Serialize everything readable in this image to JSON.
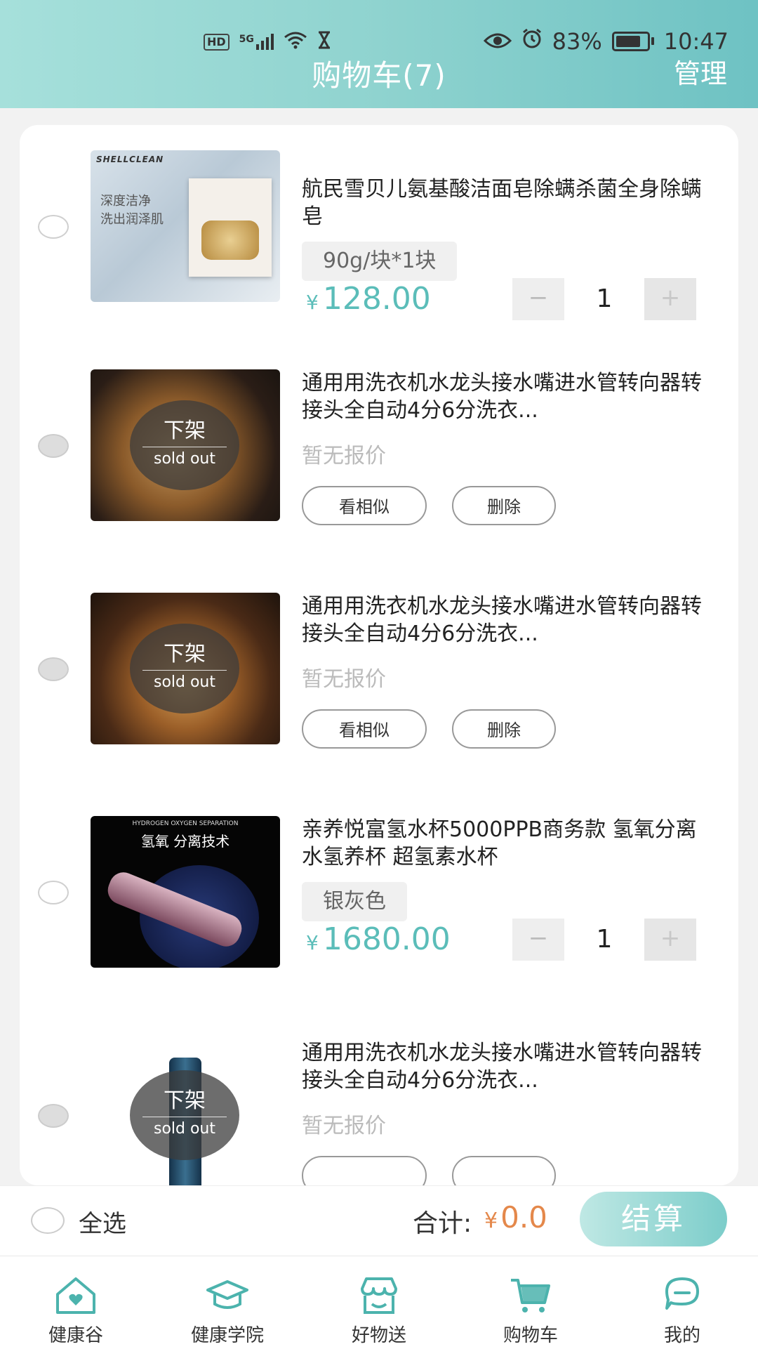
{
  "status_bar": {
    "left_icons": [
      "hd-icon",
      "signal-5g-icon",
      "wifi-icon",
      "hourglass-icon"
    ],
    "hd": "HD",
    "network": "5G",
    "battery": "83%",
    "time": "10:47"
  },
  "header": {
    "title": "购物车(7)",
    "manage": "管理"
  },
  "items": [
    {
      "name": "航民雪贝儿氨基酸洁面皂除螨杀菌全身除螨皂",
      "spec": "90g/块*1块",
      "price_symbol": "¥",
      "price": "128.00",
      "qty": "1",
      "minus": "−",
      "plus": "+"
    },
    {
      "name": "通用用洗衣机水龙头接水嘴进水管转向器转接头全自动4分6分洗衣...",
      "sold_zh": "下架",
      "sold_en": "sold out",
      "noprice": "暂无报价",
      "similar": "看相似",
      "delete": "删除"
    },
    {
      "name": "通用用洗衣机水龙头接水嘴进水管转向器转接头全自动4分6分洗衣...",
      "sold_zh": "下架",
      "sold_en": "sold out",
      "noprice": "暂无报价",
      "similar": "看相似",
      "delete": "删除"
    },
    {
      "name": "亲养悦富氢水杯5000PPB商务款 氢氧分离水氢养杯 超氢素水杯",
      "spec": "银灰色",
      "price_symbol": "¥",
      "price": "1680.00",
      "qty": "1",
      "minus": "−",
      "plus": "+"
    },
    {
      "name": "通用用洗衣机水龙头接水嘴进水管转向器转接头全自动4分6分洗衣...",
      "sold_zh": "下架",
      "sold_en": "sold out",
      "noprice": "暂无报价"
    }
  ],
  "thumbs": {
    "soap_brand": "SHELLCLEAN",
    "soap_line1": "深度洁净",
    "soap_line2": "洗出润泽肌",
    "cup_title": "氢氧 分离技术",
    "cup_sub": "HYDROGEN OXYGEN SEPARATION"
  },
  "footer": {
    "select_all": "全选",
    "total_label": "合计:",
    "total_symbol": "¥",
    "total_value": "0.0",
    "checkout": "结算"
  },
  "tabs": [
    {
      "label": "健康谷",
      "icon": "house-heart-icon"
    },
    {
      "label": "健康学院",
      "icon": "graduation-cap-icon"
    },
    {
      "label": "好物送",
      "icon": "shop-icon"
    },
    {
      "label": "购物车",
      "icon": "cart-icon"
    },
    {
      "label": "我的",
      "icon": "profile-icon"
    }
  ],
  "colors": {
    "accent": "#5bbdb9",
    "total": "#e4884b",
    "header_from": "#a6e0db",
    "header_to": "#6ec2c3"
  }
}
